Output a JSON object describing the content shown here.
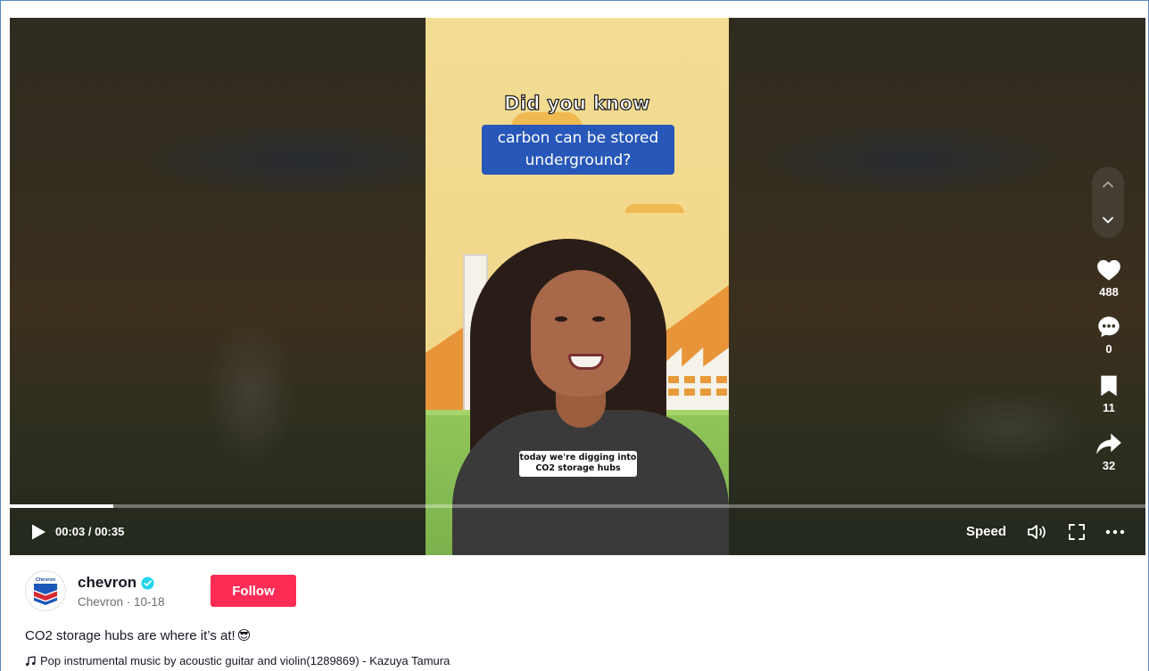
{
  "video": {
    "overlay_title": "Did you know",
    "overlay_box_line1": "carbon can be stored",
    "overlay_box_line2": "underground?",
    "caption_line1": "today we're digging into",
    "caption_line2": "CO2 storage hubs",
    "progress_fraction": 0.0915
  },
  "actions": {
    "likes": "488",
    "comments": "0",
    "saves": "11",
    "shares": "32"
  },
  "controls": {
    "time": "00:03 / 00:35",
    "speed_label": "Speed"
  },
  "author": {
    "username": "chevron",
    "display_name": "Chevron",
    "date": "10-18",
    "follow_label": "Follow",
    "avatar_text": "Chevron"
  },
  "post": {
    "description": "CO2 storage hubs are where it’s at!",
    "description_emoji": "😎",
    "music": "Pop instrumental music by acoustic guitar and violin(1289869) - Kazuya Tamura"
  },
  "colors": {
    "follow_button": "#fe2c55",
    "verified_badge": "#20d5ec",
    "overlay_box": "#2757b8"
  },
  "icons": [
    "chevron-up-icon",
    "chevron-down-icon",
    "heart-icon",
    "comment-icon",
    "bookmark-icon",
    "share-icon",
    "play-icon",
    "volume-icon",
    "fullscreen-icon",
    "more-icon",
    "verified-icon",
    "music-note-icon"
  ]
}
